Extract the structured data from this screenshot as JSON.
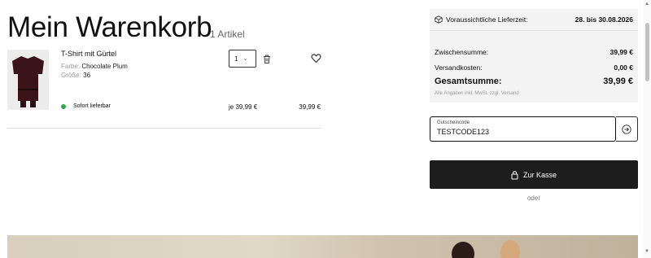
{
  "header": {
    "title": "Mein Warenkorb",
    "item_count": "1 Artikel"
  },
  "cart_item": {
    "name": "T-Shirt mit Gürtel",
    "color_label": "Farbe:",
    "color_value": "Chocolate Plum",
    "size_label": "Größe:",
    "size_value": "36",
    "quantity": "1",
    "availability": "Sofort lieferbar",
    "unit_price": "je 39,99 €",
    "line_total": "39,99 €",
    "icons": {
      "delete": "trash-icon",
      "wishlist": "heart-icon",
      "quantity": "chevron-down-icon"
    }
  },
  "summary": {
    "delivery_label": "Voraussichtliche Lieferzeit:",
    "delivery_value": "28. bis 30.08.2026",
    "subtotal_label": "Zwischensumme:",
    "subtotal_value": "39,99 €",
    "shipping_label": "Versandkosten:",
    "shipping_value": "0,00 €",
    "total_label": "Gesamtsumme:",
    "total_value": "39,99 €",
    "tax_note": "Alle Angaben inkl. MwSt. zzgl. Versand"
  },
  "voucher": {
    "label": "Gutscheincode",
    "value": "TESTCODE123"
  },
  "checkout": {
    "label": "Zur Kasse",
    "or_text": "oder"
  },
  "colors": {
    "accent": "#1d1d1d",
    "in_stock": "#2ea84a",
    "summary_bg": "#f3f3f3"
  }
}
